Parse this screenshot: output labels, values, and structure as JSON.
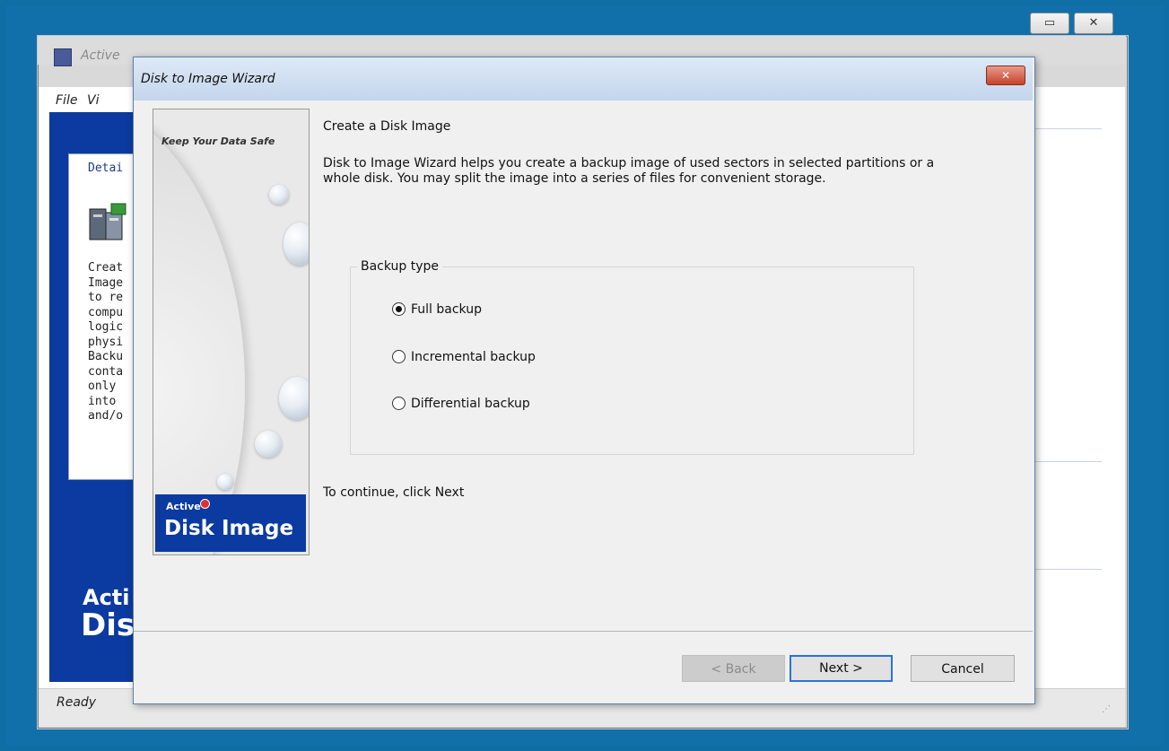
{
  "main_window": {
    "title": "Active",
    "menu": {
      "file": "File",
      "view": "Vi"
    },
    "detail_tab": "Detai",
    "detail_text": "Creat\nImage\nto re\ncompu\nlogic\nphysi\nBacku\nconta\nonly \ninto \nand/o",
    "brand_line1": "Acti",
    "brand_line2": "Dis",
    "status": "Ready"
  },
  "dialog": {
    "title": "Disk to Image Wizard",
    "art": {
      "slogan": "Keep Your Data Safe",
      "logo_small": "Active",
      "logo_big": "Disk Image"
    },
    "heading": "Create a Disk Image",
    "description": "Disk to Image Wizard helps you create a backup image of used sectors in selected partitions or a whole disk. You may split the image into a series of files for convenient storage.",
    "group_label": "Backup type",
    "options": [
      {
        "label": "Full backup",
        "selected": true
      },
      {
        "label": "Incremental backup",
        "selected": false
      },
      {
        "label": "Differential backup",
        "selected": false
      }
    ],
    "continue_text": "To continue, click Next",
    "buttons": {
      "back": "< Back",
      "next": "Next >",
      "cancel": "Cancel"
    }
  }
}
